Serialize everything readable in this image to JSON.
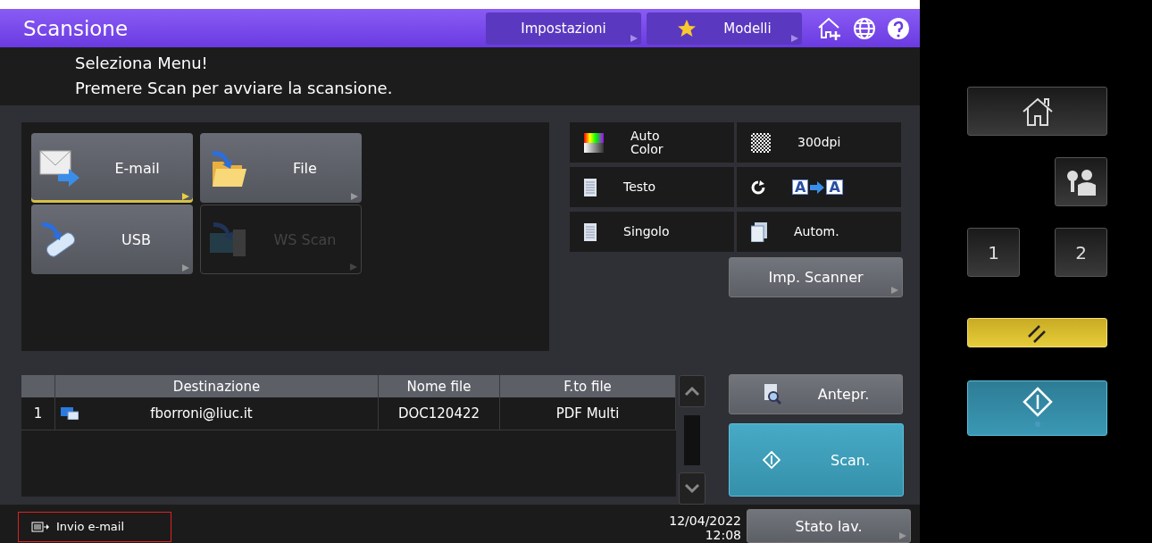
{
  "header": {
    "title": "Scansione",
    "buttons": [
      {
        "label": "Impostazioni",
        "kind": "plain"
      },
      {
        "label": "Modelli",
        "kind": "star"
      }
    ]
  },
  "messages": [
    "Seleziona Menu!",
    "Premere Scan per avviare la scansione."
  ],
  "functions": [
    {
      "label": "E-mail",
      "kind": "email",
      "selected": true,
      "disabled": false
    },
    {
      "label": "File",
      "kind": "file",
      "selected": false,
      "disabled": false
    },
    {
      "label": "USB",
      "kind": "usb",
      "selected": false,
      "disabled": false
    },
    {
      "label": "WS Scan",
      "kind": "ws",
      "selected": false,
      "disabled": true
    }
  ],
  "settings": [
    {
      "kind": "color",
      "label": "Auto\nColor"
    },
    {
      "kind": "resolution",
      "label": "300dpi"
    },
    {
      "kind": "page",
      "label": "Testo"
    },
    {
      "kind": "rotation",
      "from": "A",
      "to": "A"
    },
    {
      "kind": "page",
      "label": "Singolo"
    },
    {
      "kind": "duplex",
      "label": "Autom."
    }
  ],
  "scanner_button": "Imp. Scanner",
  "table": {
    "columns": [
      "Destinazione",
      "Nome file",
      "F.to file"
    ],
    "rows": [
      {
        "index": "1",
        "destination": "fborroni@liuc.it",
        "file_name": "DOC120422",
        "format": "PDF Multi"
      }
    ]
  },
  "preview_button": "Antepr.",
  "scan_button": "Scan.",
  "status_bar": {
    "job": "Invio e-mail",
    "date": "12/04/2022",
    "time": "12:08",
    "status_button": "Stato lav."
  },
  "hardware_keys": [
    {
      "kind": "home"
    },
    {
      "kind": "user"
    },
    {
      "kind": "number",
      "label": "1"
    },
    {
      "kind": "number",
      "label": "2"
    },
    {
      "kind": "clear"
    },
    {
      "kind": "start"
    }
  ]
}
